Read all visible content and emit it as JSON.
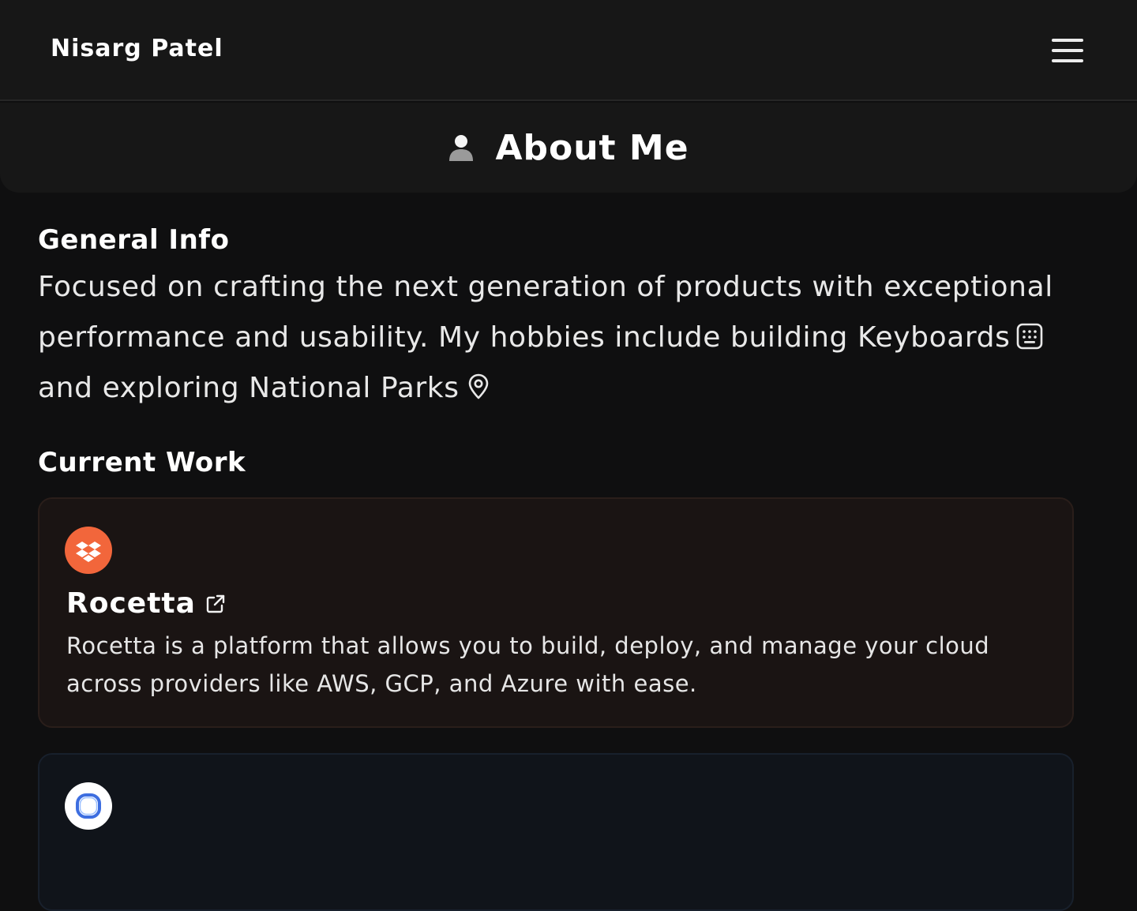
{
  "nav": {
    "brand": "Nisarg Patel",
    "menu_icon": "hamburger-menu-icon"
  },
  "header": {
    "title": "About Me",
    "icon": "person-icon"
  },
  "general_info": {
    "title": "General Info",
    "text_before_keyboard": "Focused on crafting the next generation of products with exceptional performance and usability. My hobbies include building Keyboards",
    "text_before_parks": "and exploring National Parks",
    "keyboard_icon": "keyboard-icon",
    "parks_icon": "map-pin-icon"
  },
  "current_work": {
    "title": "Current Work",
    "items": [
      {
        "name": "Rocetta",
        "description": "Rocetta is a platform that allows you to build, deploy, and manage your cloud across providers like AWS, GCP, and Azure with ease.",
        "logo_color": "#f2663b",
        "card_color": "#1a1413",
        "icon": "external-link-icon"
      },
      {
        "name": "",
        "description": "",
        "logo_color": "#ffffff",
        "card_color": "#10141a"
      }
    ]
  }
}
